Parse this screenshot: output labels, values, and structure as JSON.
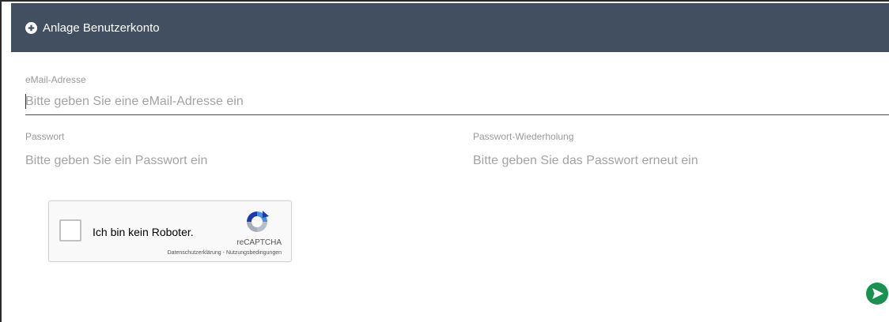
{
  "header": {
    "icon": "plus-circle-icon",
    "title": "Anlage Benutzerkonto",
    "background_color": "#424f60"
  },
  "form": {
    "email": {
      "label": "eMail-Adresse",
      "placeholder": "Bitte geben Sie eine eMail-Adresse ein",
      "value": ""
    },
    "password": {
      "label": "Passwort",
      "placeholder": "Bitte geben Sie ein Passwort ein",
      "value": ""
    },
    "password_repeat": {
      "label": "Passwort-Wiederholung",
      "placeholder": "Bitte geben Sie das Passwort erneut ein",
      "value": ""
    }
  },
  "recaptcha": {
    "checkbox_label": "Ich bin kein Roboter.",
    "brand": "reCAPTCHA",
    "privacy_link": "Datenschutzerklärung",
    "separator": " - ",
    "terms_link": "Nutzungsbedingungen",
    "icon": "recaptcha-logo-icon",
    "checked": false
  },
  "submit": {
    "icon": "arrow-right-circle-icon",
    "color": "#1a9150"
  }
}
